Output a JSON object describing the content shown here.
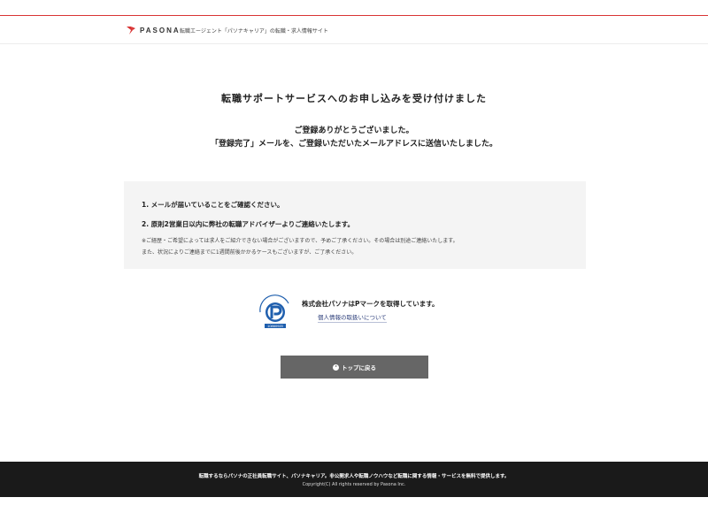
{
  "header": {
    "logo_text": "PASONA",
    "tagline": "転職エージェント「パソナキャリア」の転職・求人情報サイト",
    "accent_color": "#d93434"
  },
  "main": {
    "title": "転職サポートサービスへのお申し込みを受け付けました",
    "thanks_line1": "ご登録ありがとうございました。",
    "thanks_line2": "「登録完了」メールを、ご登録いただいたメールアドレスに送信いたしました。"
  },
  "notice": {
    "item1": "1. メールが届いていることをご確認ください。",
    "item2": "2. 原則2営業日以内に弊社の転職アドバイザーよりご連絡いたします。",
    "note1": "※ご経歴・ご希望によっては求人をご紹介できない場合がございますので、予めご了承ください。その場合は別途ご連絡いたします。",
    "note2": "また、状況によりご連絡までに1週間前後かかるケースもございますが、ご了承ください。"
  },
  "privacy": {
    "mark_number": "10860920",
    "mark_label": "たいせつにしますプライバシー",
    "text": "株式会社パソナはPマークを取得しています。",
    "link_label": "個人情報の取扱いについて",
    "mark_color": "#1f5fae"
  },
  "button": {
    "label": "トップに戻る",
    "icon": "arrow-circle-icon"
  },
  "footer": {
    "description": "転職するならパソナの正社員転職サイト、パソナキャリア。非公開求人や転職ノウハウなど転職に関する情報・サービスを無料で提供します。",
    "copyright": "Copyright(C) All rights reserved by Pasona Inc."
  }
}
